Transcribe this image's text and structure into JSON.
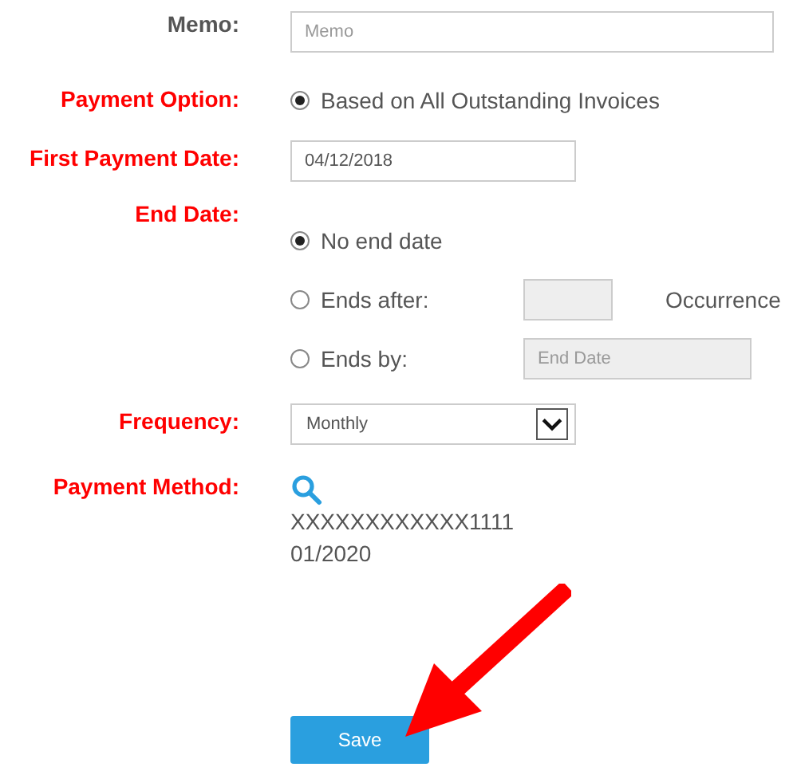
{
  "memo": {
    "label": "Memo:",
    "required": false,
    "placeholder": "Memo"
  },
  "payment_option": {
    "label": "Payment Option:",
    "required": true,
    "options": [
      {
        "label": "Based on All Outstanding Invoices",
        "selected": true
      }
    ]
  },
  "first_payment_date": {
    "label": "First Payment Date:",
    "required": true,
    "value": "04/12/2018"
  },
  "end_date": {
    "label": "End Date:",
    "required": true,
    "options": [
      {
        "kind": "plain",
        "label": "No end date",
        "selected": true
      },
      {
        "kind": "count",
        "label": "Ends after:",
        "selected": false,
        "field": {
          "disabled": true
        },
        "suffix": "Occurrence"
      },
      {
        "kind": "date",
        "label": "Ends by:",
        "selected": false,
        "field": {
          "disabled": true,
          "placeholder": "End Date"
        }
      }
    ]
  },
  "frequency": {
    "label": "Frequency:",
    "required": true,
    "value": "Monthly"
  },
  "payment_method": {
    "label": "Payment Method:",
    "required": true,
    "card_number": "XXXXXXXXXXXX1111",
    "expiry": "01/2020"
  },
  "buttons": [
    "Save"
  ]
}
